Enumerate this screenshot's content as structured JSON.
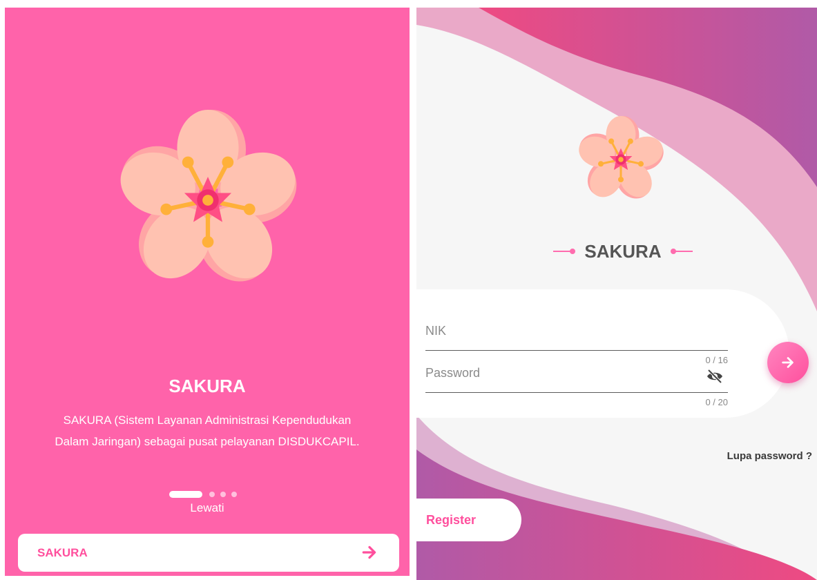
{
  "onboarding": {
    "title": "SAKURA",
    "description_line1": "SAKURA (Sistem Layanan Administrasi Kependudukan",
    "description_line2": "Dalam Jaringan) sebagai pusat pelayanan DISDUKCAPIL.",
    "page_count": 4,
    "active_page": 1,
    "skip_label": "Lewati",
    "bottom_button_label": "SAKURA",
    "bottom_button_icon": "arrow-right-icon"
  },
  "login": {
    "brand": "SAKURA",
    "nik": {
      "placeholder": "NIK",
      "value": "",
      "counter": "0 / 16"
    },
    "password": {
      "placeholder": "Password",
      "value": "",
      "counter": "0 / 20",
      "toggle_icon": "eye-off-icon"
    },
    "submit_icon": "arrow-right-icon",
    "forgot_label": "Lupa password ?",
    "register_label": "Register"
  },
  "colors": {
    "primary_pink": "#ff63aa",
    "accent_pink": "#ff4f9d",
    "gradient_start": "#e9457e",
    "gradient_end": "#b25ba6",
    "petal": "#ffc2b1",
    "petal_shadow": "#ffa5a5",
    "flower_center": "#ff4f85",
    "stamen": "#ffb03a"
  }
}
